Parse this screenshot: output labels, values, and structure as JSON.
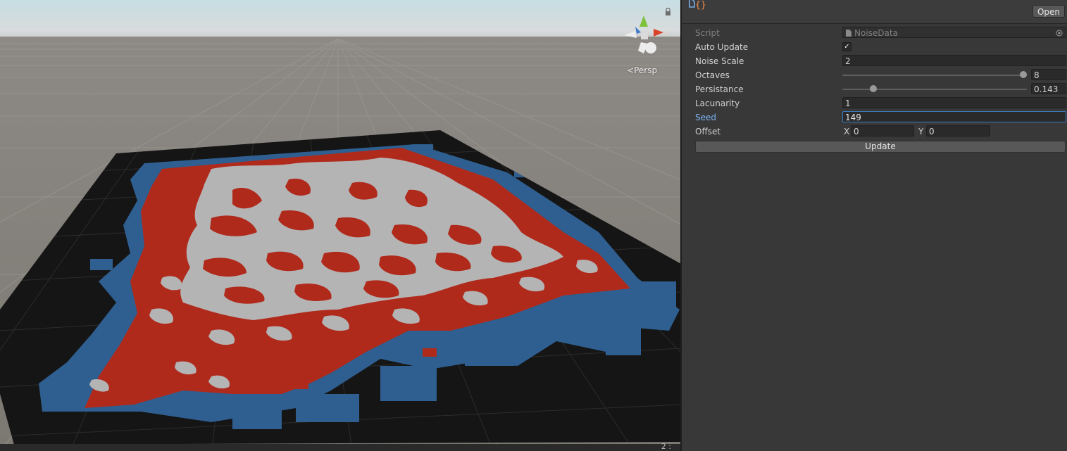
{
  "scene": {
    "view_mode": "Persp",
    "gizmo_axes": {
      "x": "x",
      "y": "y",
      "z": "z"
    },
    "status_text": "2 :"
  },
  "inspector": {
    "header_button": "Open",
    "fields": {
      "script": {
        "label": "Script",
        "value": "NoiseData"
      },
      "auto_update": {
        "label": "Auto Update",
        "checked": true,
        "check_glyph": "✓"
      },
      "noise_scale": {
        "label": "Noise Scale",
        "value": "2"
      },
      "octaves": {
        "label": "Octaves",
        "value": "8",
        "slider_fraction": 1.0
      },
      "persistance": {
        "label": "Persistance",
        "value": "0.143",
        "slider_fraction": 0.155
      },
      "lacunarity": {
        "label": "Lacunarity",
        "value": "1"
      },
      "seed": {
        "label": "Seed",
        "value": "149"
      },
      "offset": {
        "label": "Offset",
        "x_label": "X",
        "x": "0",
        "y_label": "Y",
        "y": "0"
      }
    },
    "update_button": "Update"
  },
  "colors": {
    "terrain_high": "#b4b4b4",
    "terrain_mid": "#b02a1c",
    "terrain_water": "#2e5f90",
    "plane": "#151515",
    "focus": "#7bb4f4"
  }
}
